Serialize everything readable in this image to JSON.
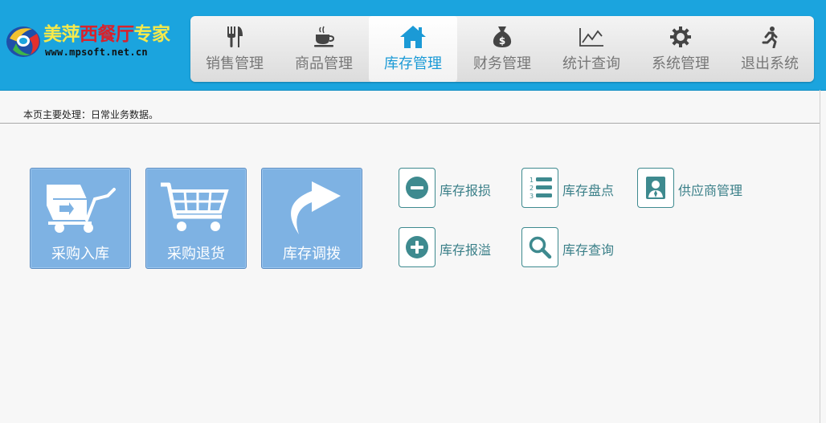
{
  "brand": {
    "title_part1": "美萍",
    "title_part2": "西餐厅",
    "title_part3": "专家",
    "url": "www.mpsoft.net.cn"
  },
  "nav": {
    "items": [
      {
        "label": "销售管理",
        "icon": "fork-knife-icon"
      },
      {
        "label": "商品管理",
        "icon": "coffee-cup-icon"
      },
      {
        "label": "库存管理",
        "icon": "home-icon",
        "active": true
      },
      {
        "label": "财务管理",
        "icon": "money-bag-icon"
      },
      {
        "label": "统计查询",
        "icon": "line-chart-icon"
      },
      {
        "label": "系统管理",
        "icon": "gear-icon"
      },
      {
        "label": "退出系统",
        "icon": "running-man-icon"
      }
    ]
  },
  "info": {
    "text": "本页主要处理：日常业务数据。"
  },
  "big_buttons": [
    {
      "label": "采购入库",
      "icon": "hand-truck-icon"
    },
    {
      "label": "采购退货",
      "icon": "shopping-cart-icon"
    },
    {
      "label": "库存调拨",
      "icon": "curved-arrow-icon"
    }
  ],
  "small_buttons": [
    {
      "label": "库存报损",
      "icon": "minus-circle-icon"
    },
    {
      "label": "库存盘点",
      "icon": "numbered-list-icon"
    },
    {
      "label": "供应商管理",
      "icon": "user-badge-icon"
    },
    {
      "label": "库存报溢",
      "icon": "plus-circle-icon"
    },
    {
      "label": "库存查询",
      "icon": "magnifier-icon"
    }
  ],
  "colors": {
    "header": "#1ba4de",
    "active_nav_text": "#1b9ad6",
    "tile": "#7eb2e3",
    "small_label": "#3a7f88",
    "small_icon": "#3e8a8f"
  }
}
